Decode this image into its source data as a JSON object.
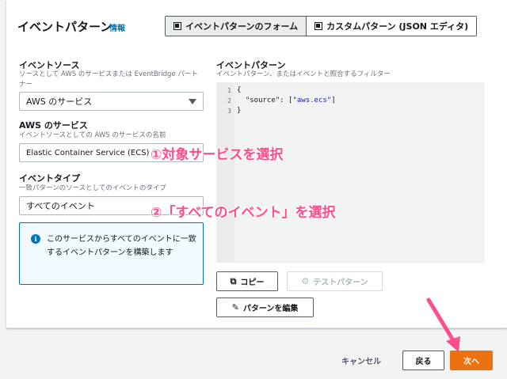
{
  "panel": {
    "title": "イベントパターン",
    "info_link": "情報",
    "segmented": {
      "option_form": "イベントパターンのフォーム",
      "option_custom": "カスタムパターン (JSON エディタ)",
      "selected": "option_form"
    }
  },
  "left": {
    "event_source": {
      "label": "イベントソース",
      "description": "ソースとして AWS のサービスまたは EventBridge パートナー",
      "value": "AWS のサービス"
    },
    "aws_service": {
      "label": "AWS のサービス",
      "description": "イベントソースとしての AWS のサービスの名前",
      "value": "Elastic Container Service (ECS)"
    },
    "event_type": {
      "label": "イベントタイプ",
      "description": "一致パターンのソースとしてのイベントのタイプ",
      "value": "すべてのイベント"
    },
    "info_box": {
      "icon": "info-circle-icon",
      "text": "このサービスからすべてのイベントに一致するイベントパターンを構築します"
    }
  },
  "right": {
    "label": "イベントパターン",
    "description": "イベントパターン、またはイベントと照合するフィルター",
    "editor": {
      "line_numbers": [
        "1",
        "2",
        "3"
      ],
      "line1": "{",
      "line2_key": "  \"source\": [",
      "line2_value": "\"aws.ecs\"",
      "line2_end": "]",
      "line3": "}"
    },
    "buttons": {
      "copy": "コピー",
      "test": "テストパターン",
      "edit": "パターンを編集"
    }
  },
  "footer": {
    "cancel": "キャンセル",
    "back": "戻る",
    "next": "次へ"
  },
  "annotations": {
    "step1": "①対象サービスを選択",
    "step2": "②「すべてのイベント」を選択"
  },
  "colors": {
    "accent_orange": "#ec7211",
    "link_blue": "#0073bb",
    "annotation_pink": "#ff4d8d"
  }
}
